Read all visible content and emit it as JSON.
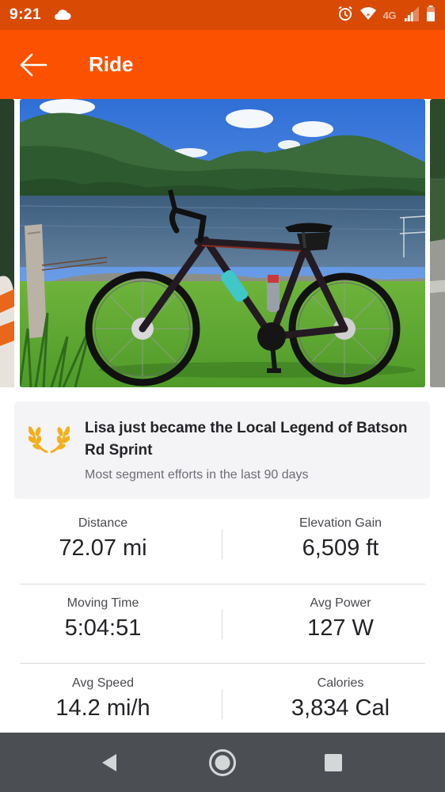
{
  "status_bar": {
    "time": "9:21",
    "network": "4G",
    "icons": [
      "cloud-icon",
      "alarm-icon",
      "wifi-icon",
      "signal-icon",
      "battery-icon"
    ]
  },
  "app_bar": {
    "title": "Ride",
    "back_icon": "arrow-left-icon",
    "color": "#fc5200"
  },
  "local_legend": {
    "icon": "laurel-icon",
    "title": "Lisa just became the Local Legend of Batson Rd Sprint",
    "subtitle": "Most segment efforts in the last 90 days"
  },
  "stats": [
    {
      "label": "Distance",
      "value": "72.07 mi"
    },
    {
      "label": "Elevation Gain",
      "value": "6,509 ft"
    },
    {
      "label": "Moving Time",
      "value": "5:04:51"
    },
    {
      "label": "Avg Power",
      "value": "127 W"
    },
    {
      "label": "Avg Speed",
      "value": "14.2 mi/h"
    },
    {
      "label": "Calories",
      "value": "3,834 Cal"
    }
  ],
  "nav_bar": {
    "buttons": [
      "back-triangle-icon",
      "home-circle-icon",
      "recents-square-icon"
    ]
  }
}
